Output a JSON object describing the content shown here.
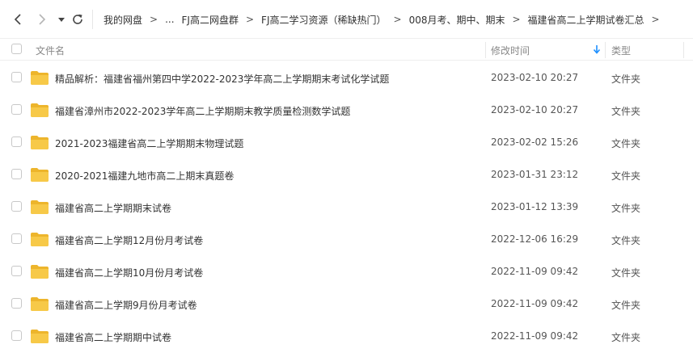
{
  "nav": {
    "back_icon": "chevron-left-icon",
    "forward_icon": "chevron-right-icon",
    "dropdown_icon": "caret-down-icon",
    "refresh_icon": "refresh-icon"
  },
  "breadcrumb": {
    "separator": ">",
    "items": [
      "我的网盘",
      "...",
      "FJ高二网盘群",
      "FJ高二学习资源（稀缺热门）",
      "008月考、期中、期末",
      "福建省高二上学期试卷汇总"
    ]
  },
  "columns": {
    "name": "文件名",
    "modified": "修改时间",
    "type": "类型",
    "sort_icon": "arrow-down-icon"
  },
  "colors": {
    "folder": "#F7C948",
    "folder_back": "#EDB52C",
    "sort_arrow": "#1E90FF"
  },
  "files": [
    {
      "name": "精品解析：福建省福州第四中学2022-2023学年高二上学期期末考试化学试题",
      "modified": "2023-02-10 20:27",
      "type": "文件夹",
      "icon": "folder-icon"
    },
    {
      "name": "福建省漳州市2022-2023学年高二上学期期末教学质量检测数学试题",
      "modified": "2023-02-10 20:27",
      "type": "文件夹",
      "icon": "folder-icon"
    },
    {
      "name": "2021-2023福建省高二上学期期末物理试题",
      "modified": "2023-02-02 15:26",
      "type": "文件夹",
      "icon": "folder-icon"
    },
    {
      "name": "2020-2021福建九地市高二上期末真题卷",
      "modified": "2023-01-31 23:12",
      "type": "文件夹",
      "icon": "folder-icon"
    },
    {
      "name": "福建省高二上学期期末试卷",
      "modified": "2023-01-12 13:39",
      "type": "文件夹",
      "icon": "folder-icon"
    },
    {
      "name": "福建省高二上学期12月份月考试卷",
      "modified": "2022-12-06 16:29",
      "type": "文件夹",
      "icon": "folder-icon"
    },
    {
      "name": "福建省高二上学期10月份月考试卷",
      "modified": "2022-11-09 09:42",
      "type": "文件夹",
      "icon": "folder-icon"
    },
    {
      "name": "福建省高二上学期9月份月考试卷",
      "modified": "2022-11-09 09:42",
      "type": "文件夹",
      "icon": "folder-icon"
    },
    {
      "name": "福建省高二上学期期中试卷",
      "modified": "2022-11-09 09:42",
      "type": "文件夹",
      "icon": "folder-icon"
    }
  ]
}
